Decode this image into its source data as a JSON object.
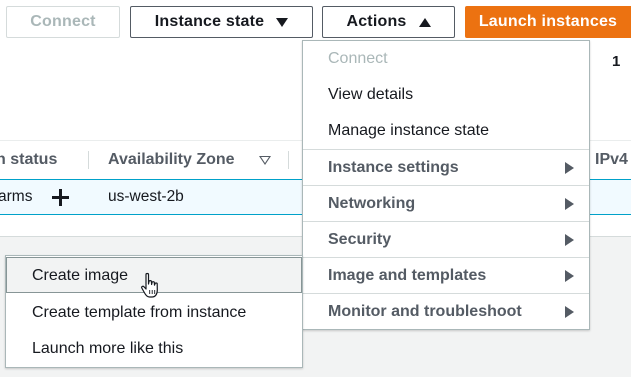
{
  "toolbar": {
    "connect_label": "Connect",
    "instance_state_label": "Instance state",
    "actions_label": "Actions",
    "launch_label": "Launch instances",
    "page_count": "1"
  },
  "table": {
    "headers": {
      "status": "n status",
      "availability_zone": "Availability Zone",
      "ipv4": "IPv4"
    },
    "row": {
      "alarms": "arms",
      "availability_zone": "us-west-2b"
    }
  },
  "actions_menu": {
    "connect": "Connect",
    "view_details": "View details",
    "manage_instance_state": "Manage instance state",
    "groups": [
      "Instance settings",
      "Networking",
      "Security",
      "Image and templates",
      "Monitor and troubleshoot"
    ]
  },
  "image_submenu": {
    "items": [
      "Create image",
      "Create template from instance",
      "Launch more like this"
    ]
  },
  "colors": {
    "primary_orange": "#ec7211",
    "selected_row": "#f1faff",
    "selected_border": "#00a1c9"
  }
}
